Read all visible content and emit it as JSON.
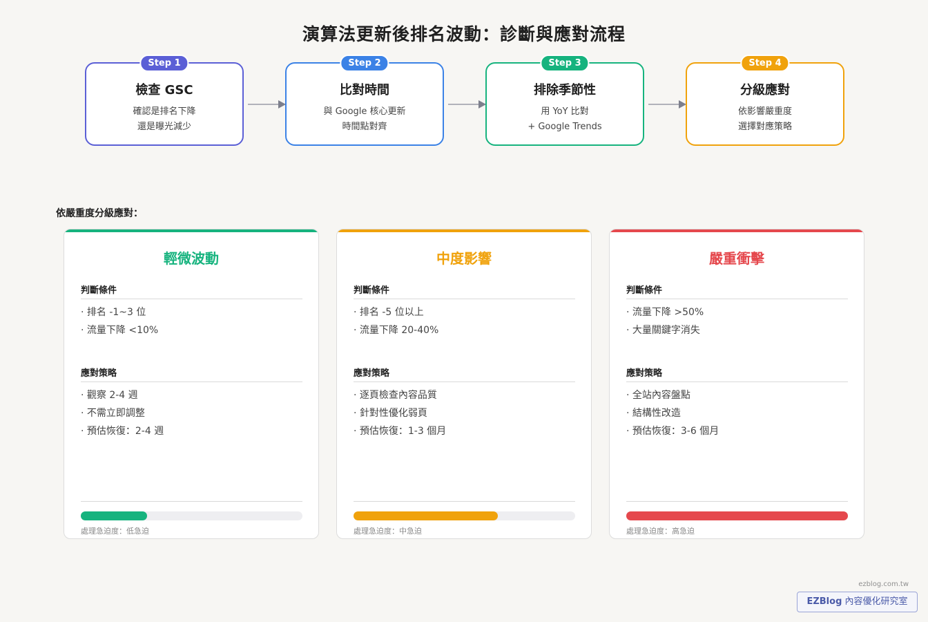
{
  "title": "演算法更新後排名波動：診斷與應對流程",
  "steps": [
    {
      "badge": "Step 1",
      "title": "檢查 GSC",
      "line1": "確認是排名下降",
      "line2": "還是曝光減少",
      "color": "#5b5fd6"
    },
    {
      "badge": "Step 2",
      "title": "比對時間",
      "line1": "與 Google 核心更新",
      "line2": "時間點對齊",
      "color": "#3b82e6"
    },
    {
      "badge": "Step 3",
      "title": "排除季節性",
      "line1": "用 YoY 比對",
      "line2": "+ Google Trends",
      "color": "#16b37e"
    },
    {
      "badge": "Step 4",
      "title": "分級應對",
      "line1": "依影響嚴重度",
      "line2": "選擇對應策略",
      "color": "#f0a20c"
    }
  ],
  "section_label": "依嚴重度分級應對：",
  "cards": [
    {
      "title": "輕微波動",
      "color": "#16b37e",
      "cond_heading": "判斷條件",
      "conditions": [
        "· 排名 -1~3 位",
        "· 流量下降 <10%"
      ],
      "strat_heading": "應對策略",
      "strategies": [
        "· 觀察 2-4 週",
        "· 不需立即調整",
        "· 預估恢復：2-4 週"
      ],
      "urgency_level": 0.3,
      "urgency_label": "處理急迫度：低急迫"
    },
    {
      "title": "中度影響",
      "color": "#f0a20c",
      "cond_heading": "判斷條件",
      "conditions": [
        "· 排名 -5 位以上",
        "· 流量下降 20-40%"
      ],
      "strat_heading": "應對策略",
      "strategies": [
        "· 逐頁檢查內容品質",
        "· 針對性優化弱頁",
        "· 預估恢復：1-3 個月"
      ],
      "urgency_level": 0.65,
      "urgency_label": "處理急迫度：中急迫"
    },
    {
      "title": "嚴重衝擊",
      "color": "#e5484d",
      "cond_heading": "判斷條件",
      "conditions": [
        "· 流量下降 >50%",
        "· 大量關鍵字消失"
      ],
      "strat_heading": "應對策略",
      "strategies": [
        "· 全站內容盤點",
        "· 結構性改造",
        "· 預估恢復：3-6 個月"
      ],
      "urgency_level": 1.0,
      "urgency_label": "處理急迫度：高急迫"
    }
  ],
  "footer": {
    "site": "ezblog.com.tw",
    "brand_bold": "EZBlog",
    "brand_rest": " 內容優化研究室"
  }
}
